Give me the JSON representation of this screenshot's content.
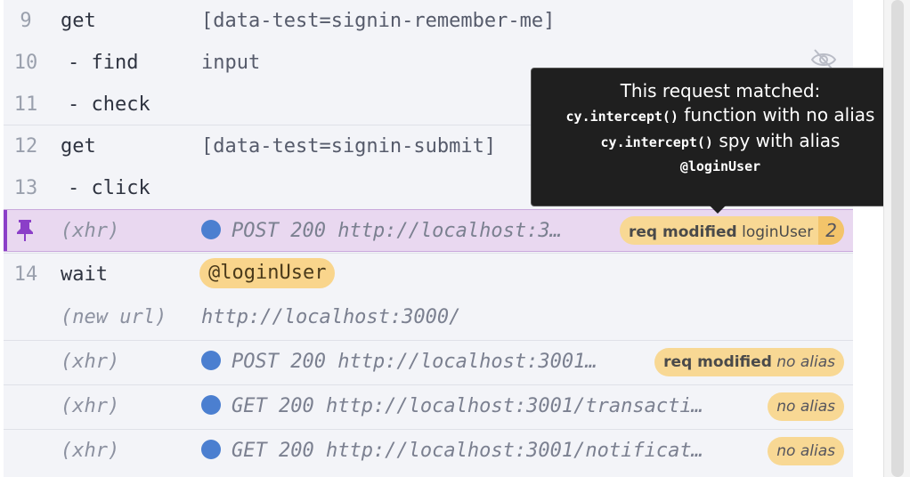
{
  "log": {
    "rows": [
      {
        "num": "9",
        "cmd": "get",
        "msg": "[data-test=signin-remember-me]"
      },
      {
        "num": "10",
        "cmd": "- find",
        "msg": "input"
      },
      {
        "num": "11",
        "cmd": "- check",
        "msg": ""
      },
      {
        "num": "12",
        "cmd": "get",
        "msg": "[data-test=signin-submit]"
      },
      {
        "num": "13",
        "cmd": "- click",
        "msg": ""
      },
      {
        "num": "",
        "cmd": "(xhr)",
        "msg": "POST 200 http://localhost:3…",
        "badge_strong": "req modified",
        "badge_alias": "loginUser",
        "badge_count": "2"
      },
      {
        "num": "14",
        "cmd": "wait",
        "msg": "@loginUser"
      },
      {
        "num": "",
        "cmd": "(new url)",
        "msg": "http://localhost:3000/"
      },
      {
        "num": "",
        "cmd": "(xhr)",
        "msg": "POST 200 http://localhost:3001…",
        "badge_strong": "req modified",
        "badge_alias": "no alias"
      },
      {
        "num": "",
        "cmd": "(xhr)",
        "msg": "GET 200 http://localhost:3001/transacti…",
        "badge_alias": "no alias"
      },
      {
        "num": "",
        "cmd": "(xhr)",
        "msg": "GET 200 http://localhost:3001/notificat…",
        "badge_alias": "no alias"
      }
    ]
  },
  "tooltip": {
    "line1": "This request matched:",
    "code1": "cy.intercept()",
    "text1": " function with no alias",
    "code2": "cy.intercept()",
    "text2": " spy with alias",
    "alias": "@loginUser"
  },
  "icons": {
    "pin": "pin-icon",
    "eye": "eye-slash-icon",
    "dot": "xhr-status-dot-icon"
  },
  "colors": {
    "pinned_row": "#e9d8f0",
    "pin_accent": "#8b3fc8",
    "badge": "#f8d894",
    "dot": "#4b7fd0",
    "tooltip_bg": "#1f1f1f"
  }
}
